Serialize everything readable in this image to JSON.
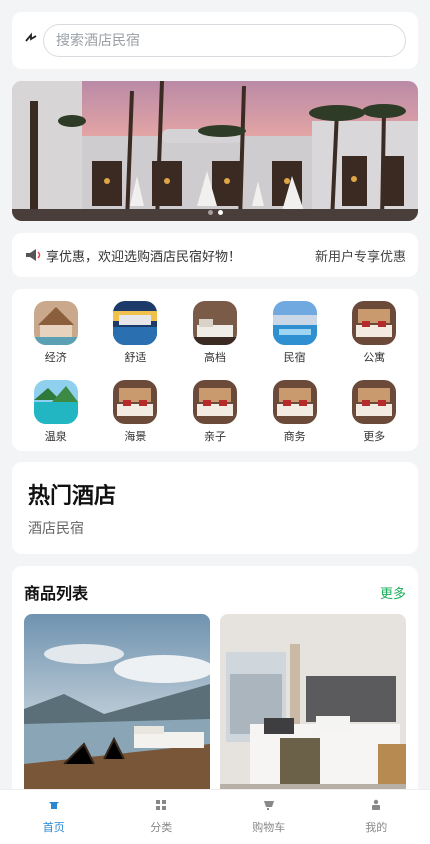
{
  "search": {
    "placeholder": "搜索酒店民宿",
    "icon": "scan-icon"
  },
  "banner": {
    "active_dot": 1,
    "dot_count": 2
  },
  "notice": {
    "icon": "megaphone-icon",
    "text": "享优惠，欢迎选购酒店民宿好物！",
    "right": "新用户专享优惠"
  },
  "categories": [
    {
      "label": "经济"
    },
    {
      "label": "舒适"
    },
    {
      "label": "高档"
    },
    {
      "label": "民宿"
    },
    {
      "label": "公寓"
    },
    {
      "label": "温泉"
    },
    {
      "label": "海景"
    },
    {
      "label": "亲子"
    },
    {
      "label": "商务"
    },
    {
      "label": "更多"
    }
  ],
  "hot": {
    "title": "热门酒店",
    "subtitle": "酒店民宿"
  },
  "product_list": {
    "title": "商品列表",
    "more": "更多"
  },
  "tabbar": {
    "accent": "#2a87d2",
    "items": [
      {
        "label": "首页",
        "icon": "home-icon"
      },
      {
        "label": "分类",
        "icon": "grid-icon"
      },
      {
        "label": "购物车",
        "icon": "cart-icon"
      },
      {
        "label": "我的",
        "icon": "user-icon"
      }
    ]
  }
}
